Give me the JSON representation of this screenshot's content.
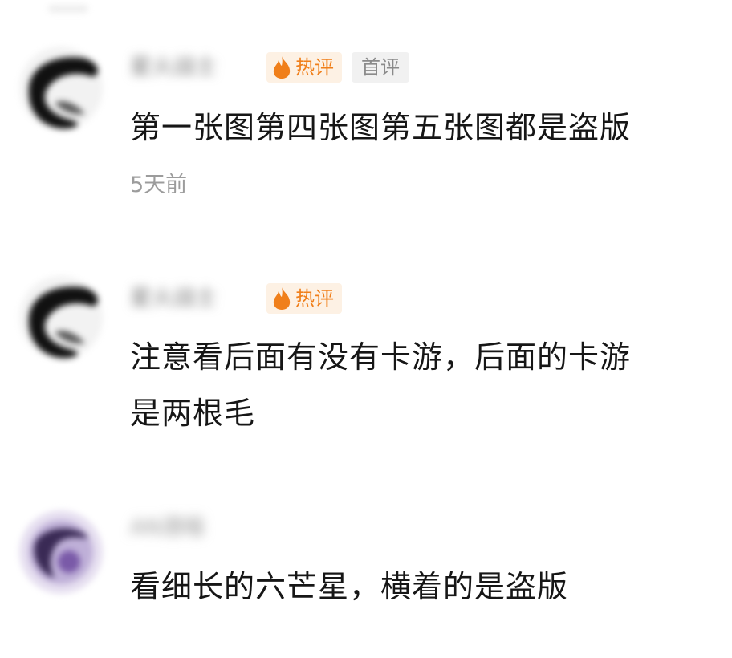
{
  "comments": [
    {
      "username": "星火战士",
      "hot_label": "热评",
      "first_label": "首评",
      "text": "第一张图第四张图第五张图都是盗版",
      "time": "5天前"
    },
    {
      "username": "星火战士",
      "hot_label": "热评",
      "text": "注意看后面有没有卡游，后面的卡游\n是两根毛"
    },
    {
      "username": "AN酒喵",
      "text": "看细长的六芒星，横着的是盗版"
    }
  ],
  "colors": {
    "hot_accent": "#f07f1a",
    "hot_badge_bg": "#fdf1e4",
    "first_badge_bg": "#f1f1f1",
    "time_gray": "#9c9c9c",
    "text": "#161616"
  },
  "icons": {
    "hot": "flame-icon"
  }
}
